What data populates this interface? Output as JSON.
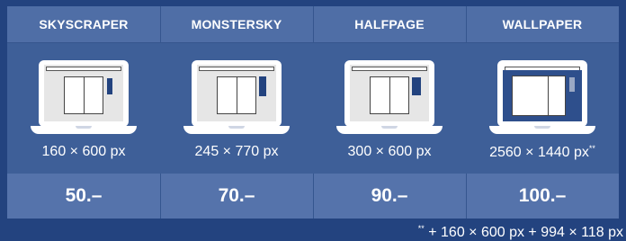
{
  "columns": [
    {
      "title": "SKYSCRAPER",
      "size": "160 × 600 px",
      "price": "50.–",
      "footnote_mark": ""
    },
    {
      "title": "MONSTERSKY",
      "size": "245 × 770 px",
      "price": "70.–",
      "footnote_mark": ""
    },
    {
      "title": "HALFPAGE",
      "size": "300 × 600 px",
      "price": "90.–",
      "footnote_mark": ""
    },
    {
      "title": "WALLPAPER",
      "size": "2560 × 1440 px",
      "price": "100.–",
      "footnote_mark": "**"
    }
  ],
  "footnote": {
    "mark": "**",
    "text": " + 160 × 600 px + 994 × 118 px"
  },
  "colors": {
    "background": "#23437f",
    "panel": "#3e5f98",
    "header_row": "#4f6ea6",
    "price_row": "#5573ab",
    "ad_block": "#23437f"
  }
}
